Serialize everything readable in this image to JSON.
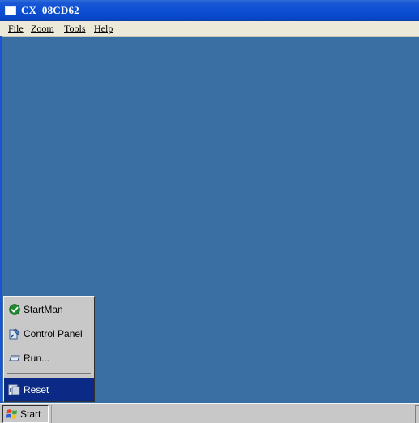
{
  "window": {
    "title": "CX_08CD62"
  },
  "menubar": {
    "items": [
      {
        "label": "File"
      },
      {
        "label": "Zoom"
      },
      {
        "label": "Tools"
      },
      {
        "label": "Help"
      }
    ]
  },
  "start_menu": {
    "items": [
      {
        "label": "StartMan",
        "icon": "check-circle-icon"
      },
      {
        "label": "Control Panel",
        "icon": "control-panel-icon"
      },
      {
        "label": "Run...",
        "icon": "run-icon"
      },
      {
        "label": "Reset",
        "icon": "reset-icon",
        "selected": true
      }
    ]
  },
  "taskbar": {
    "start_label": "Start"
  },
  "colors": {
    "desktop": "#3a6fa4",
    "titlebar": "#0c4fd2",
    "menu_selected": "#0a2a85",
    "menu_bg": "#c8c8c8"
  }
}
